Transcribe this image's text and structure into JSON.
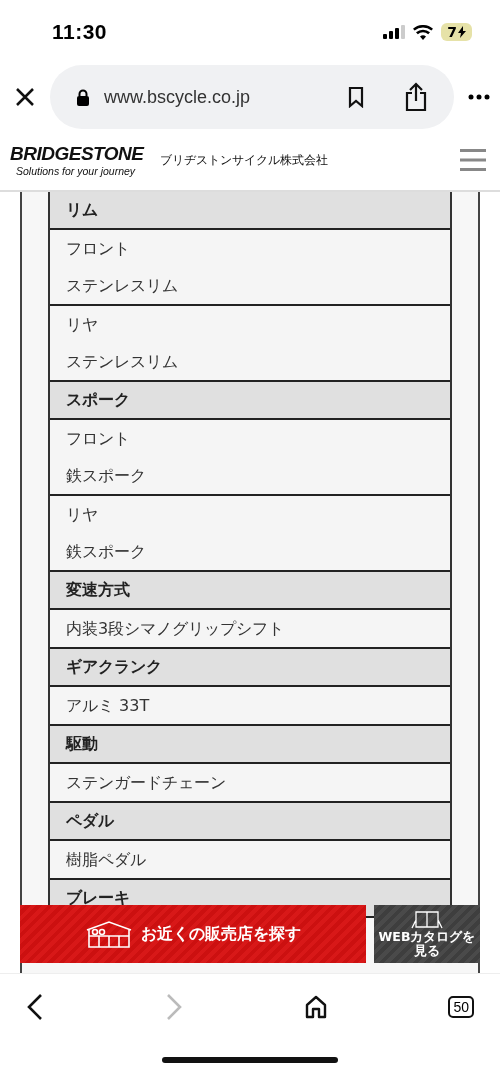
{
  "status_bar": {
    "time": "11:30",
    "battery": "7",
    "charging": true
  },
  "browser_bar": {
    "url": "www.bscycle.co.jp"
  },
  "site_header": {
    "logo": "BRIDGESTONE",
    "tagline": "Solutions for your journey",
    "company": "ブリヂストンサイクル株式会社"
  },
  "spec_table": {
    "sections": [
      {
        "title": "リム",
        "items": [
          {
            "lines": [
              "フロント",
              "ステンレスリム"
            ]
          },
          {
            "lines": [
              "リヤ",
              "ステンレスリム"
            ]
          }
        ]
      },
      {
        "title": "スポーク",
        "items": [
          {
            "lines": [
              "フロント",
              "鉄スポーク"
            ]
          },
          {
            "lines": [
              "リヤ",
              "鉄スポーク"
            ]
          }
        ]
      },
      {
        "title": "変速方式",
        "items": [
          {
            "lines": [
              "内装3段シマノグリップシフト"
            ]
          }
        ]
      },
      {
        "title": "ギアクランク",
        "items": [
          {
            "lines": [
              "アルミ 33T"
            ]
          }
        ]
      },
      {
        "title": "駆動",
        "items": [
          {
            "lines": [
              "ステンガードチェーン"
            ]
          }
        ]
      },
      {
        "title": "ペダル",
        "items": [
          {
            "lines": [
              "樹脂ペダル"
            ]
          }
        ]
      },
      {
        "title": "ブレーキ"
      }
    ]
  },
  "banner": {
    "dealer_button": "お近くの販売店を探す",
    "catalog_button": "WEBカタログを見る"
  },
  "toolbar": {
    "tabs_count": "50"
  }
}
